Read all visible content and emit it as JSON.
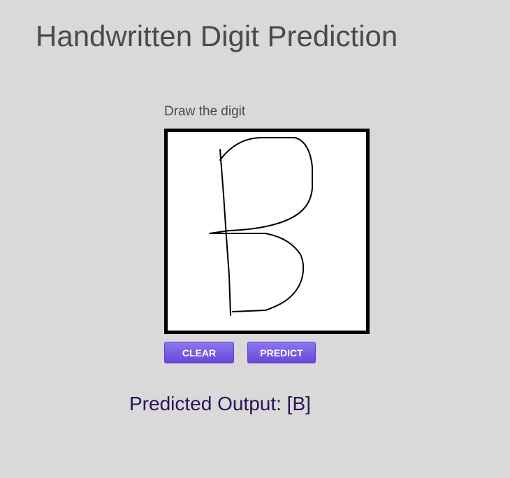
{
  "page": {
    "title": "Handwritten Digit Prediction"
  },
  "canvas": {
    "label": "Draw the digit",
    "drawn_content": "B"
  },
  "buttons": {
    "clear_label": "CLEAR",
    "predict_label": "PREDICT"
  },
  "output": {
    "text": "Predicted Output: [B]"
  },
  "colors": {
    "background": "#d9d9d9",
    "button": "#7058e0",
    "output_text": "#2b1357"
  }
}
